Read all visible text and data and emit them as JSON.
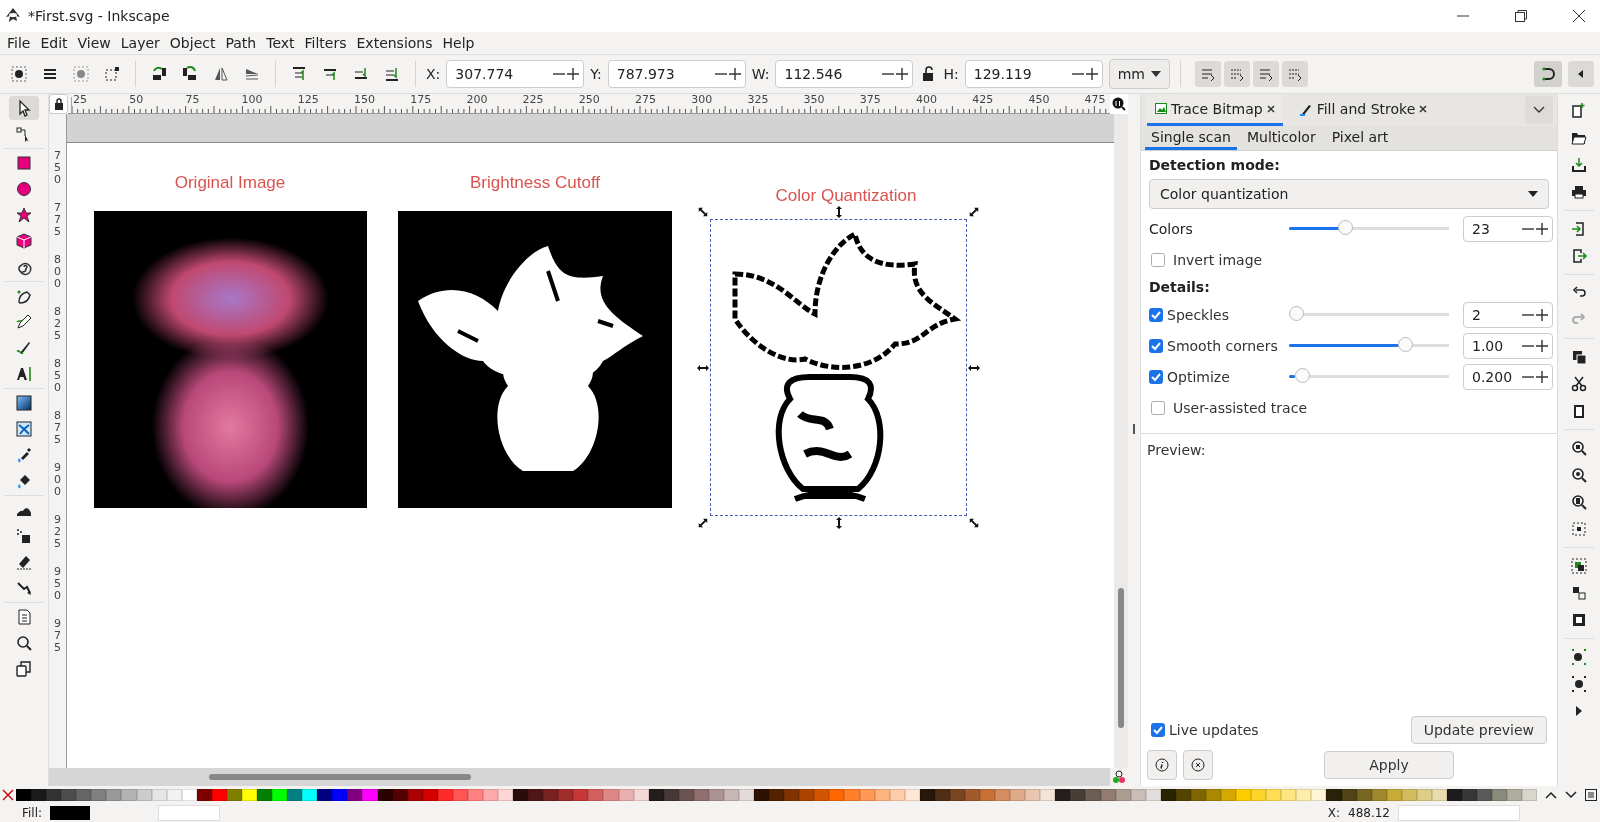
{
  "window": {
    "title": "*First.svg - Inkscape"
  },
  "menu": [
    "File",
    "Edit",
    "View",
    "Layer",
    "Object",
    "Path",
    "Text",
    "Filters",
    "Extensions",
    "Help"
  ],
  "toolbar": {
    "fields": [
      {
        "label": "X:",
        "value": "307.774"
      },
      {
        "label": "Y:",
        "value": "787.973"
      },
      {
        "label": "W:",
        "value": "112.546"
      },
      {
        "label": "H:",
        "value": "129.119"
      }
    ],
    "unit": "mm",
    "snap": {
      "on": true
    }
  },
  "tools": [
    {
      "selected": true
    },
    {
      "selected": false
    },
    {
      "selected": false
    },
    {
      "selected": false
    },
    {
      "selected": false
    },
    {
      "selected": false
    },
    {
      "selected": false
    },
    {
      "selected": false
    },
    {
      "selected": false
    },
    {
      "selected": false
    },
    {
      "selected": false
    },
    {
      "selected": false
    },
    {
      "selected": false
    },
    {
      "selected": false
    },
    {
      "selected": false
    },
    {
      "selected": false
    },
    {
      "selected": false
    },
    {
      "selected": false
    },
    {
      "selected": false
    },
    {
      "selected": false
    },
    {
      "selected": false
    },
    {
      "selected": false
    }
  ],
  "ruler": {
    "horizontal": [
      "25",
      "50",
      "75",
      "100",
      "125",
      "150",
      "175",
      "200",
      "225",
      "250",
      "275",
      "300",
      "325",
      "350",
      "375",
      "400",
      "425",
      "450",
      "475"
    ],
    "vertical": [
      "750",
      "775",
      "800",
      "825",
      "850",
      "875",
      "900",
      "925",
      "950",
      "975"
    ]
  },
  "canvas": {
    "items": [
      {
        "kind": "photo",
        "caption": "Original Image",
        "selected": false
      },
      {
        "kind": "threshold",
        "caption": "Brightness Cutoff",
        "selected": false
      },
      {
        "kind": "trace",
        "caption": "Color Quantization",
        "selected": true
      }
    ]
  },
  "panel": {
    "tabs": [
      {
        "label": "Trace Bitmap",
        "selected": true
      },
      {
        "label": "Fill and Stroke",
        "selected": false
      }
    ],
    "modes": [
      {
        "label": "Single scan",
        "selected": true
      },
      {
        "label": "Multicolor",
        "selected": false
      },
      {
        "label": "Pixel art",
        "selected": false
      }
    ],
    "detection_label": "Detection mode:",
    "detection_mode": "Color quantization",
    "rows": [
      {
        "kind": "slider",
        "label": "Colors",
        "level": 0.34,
        "value": "23"
      },
      {
        "kind": "check",
        "label": "Invert image",
        "checked": false
      },
      {
        "kind": "heading",
        "label": "Details:"
      },
      {
        "kind": "checkslider",
        "label": "Speckles",
        "checked": true,
        "level": 0,
        "value": "2"
      },
      {
        "kind": "checkslider",
        "label": "Smooth corners",
        "checked": true,
        "level": 0.75,
        "value": "1.00"
      },
      {
        "kind": "checkslider",
        "label": "Optimize",
        "checked": true,
        "level": 0.04,
        "value": "0.200"
      },
      {
        "kind": "check",
        "label": "User-assisted trace",
        "checked": false
      }
    ],
    "preview_label": "Preview:",
    "live_updates": {
      "label": "Live updates",
      "checked": true
    },
    "update_button": "Update preview",
    "apply_button": "Apply"
  },
  "palette": [
    {
      "color": "#000000"
    },
    {
      "color": "#1a1a1a"
    },
    {
      "color": "#333333"
    },
    {
      "color": "#4d4d4d"
    },
    {
      "color": "#666666"
    },
    {
      "color": "#808080"
    },
    {
      "color": "#999999"
    },
    {
      "color": "#b3b3b3"
    },
    {
      "color": "#cccccc"
    },
    {
      "color": "#e6e6e6"
    },
    {
      "color": "#f2f2f2"
    },
    {
      "color": "#ffffff"
    },
    {
      "color": "#800000"
    },
    {
      "color": "#ff0000"
    },
    {
      "color": "#808000"
    },
    {
      "color": "#ffff00"
    },
    {
      "color": "#008000"
    },
    {
      "color": "#00ff00"
    },
    {
      "color": "#008080"
    },
    {
      "color": "#00ffff"
    },
    {
      "color": "#000080"
    },
    {
      "color": "#0000ff"
    },
    {
      "color": "#800080"
    },
    {
      "color": "#ff00ff"
    },
    {
      "color": "#2b0000"
    },
    {
      "color": "#550000"
    },
    {
      "color": "#aa0000"
    },
    {
      "color": "#d40000"
    },
    {
      "color": "#ff2a2a"
    },
    {
      "color": "#ff5555"
    },
    {
      "color": "#ff8080"
    },
    {
      "color": "#ffaaaa"
    },
    {
      "color": "#ffd5d5"
    },
    {
      "color": "#280b0b"
    },
    {
      "color": "#501616"
    },
    {
      "color": "#782121"
    },
    {
      "color": "#a02c2c"
    },
    {
      "color": "#c83737"
    },
    {
      "color": "#d35f5f"
    },
    {
      "color": "#de8787"
    },
    {
      "color": "#e9afaf"
    },
    {
      "color": "#f4d7d7"
    },
    {
      "color": "#241c1c"
    },
    {
      "color": "#483737"
    },
    {
      "color": "#6c5353"
    },
    {
      "color": "#916f6f"
    },
    {
      "color": "#ac9393"
    },
    {
      "color": "#c8b7b7"
    },
    {
      "color": "#e3dbdb"
    },
    {
      "color": "#2b1100"
    },
    {
      "color": "#552200"
    },
    {
      "color": "#803300"
    },
    {
      "color": "#aa4400"
    },
    {
      "color": "#d45500"
    },
    {
      "color": "#ff6600"
    },
    {
      "color": "#ff7f2a"
    },
    {
      "color": "#ff9955"
    },
    {
      "color": "#ffb380"
    },
    {
      "color": "#ffccaa"
    },
    {
      "color": "#ffe6d5"
    },
    {
      "color": "#28170b"
    },
    {
      "color": "#502d16"
    },
    {
      "color": "#784421"
    },
    {
      "color": "#a05a2c"
    },
    {
      "color": "#c87137"
    },
    {
      "color": "#d38d5f"
    },
    {
      "color": "#deaa87"
    },
    {
      "color": "#e9c6af"
    },
    {
      "color": "#f4e3d7"
    },
    {
      "color": "#241f1c"
    },
    {
      "color": "#483e37"
    },
    {
      "color": "#6c5d53"
    },
    {
      "color": "#917c6f"
    },
    {
      "color": "#ac9d93"
    },
    {
      "color": "#c8beb7"
    },
    {
      "color": "#e3dedb"
    },
    {
      "color": "#2b2200"
    },
    {
      "color": "#554400"
    },
    {
      "color": "#806600"
    },
    {
      "color": "#aa8800"
    },
    {
      "color": "#d4aa00"
    },
    {
      "color": "#ffcc00"
    },
    {
      "color": "#ffd42a"
    },
    {
      "color": "#ffdd55"
    },
    {
      "color": "#ffe680"
    },
    {
      "color": "#ffeeaa"
    },
    {
      "color": "#fff6d5"
    },
    {
      "color": "#28220b"
    },
    {
      "color": "#504416"
    },
    {
      "color": "#786721"
    },
    {
      "color": "#a0892c"
    },
    {
      "color": "#c8ab37"
    },
    {
      "color": "#d3bc5f"
    },
    {
      "color": "#decd87"
    },
    {
      "color": "#e9ddaf"
    },
    {
      "color": "#1c1c1c"
    },
    {
      "color": "#37373a"
    },
    {
      "color": "#5a5a5a"
    },
    {
      "color": "#8a8a7a"
    },
    {
      "color": "#b0ad9f"
    },
    {
      "color": "#d8d6cc"
    }
  ],
  "status": {
    "fill_label": "Fill:",
    "x_label": "X:",
    "x_value": "488.12"
  }
}
